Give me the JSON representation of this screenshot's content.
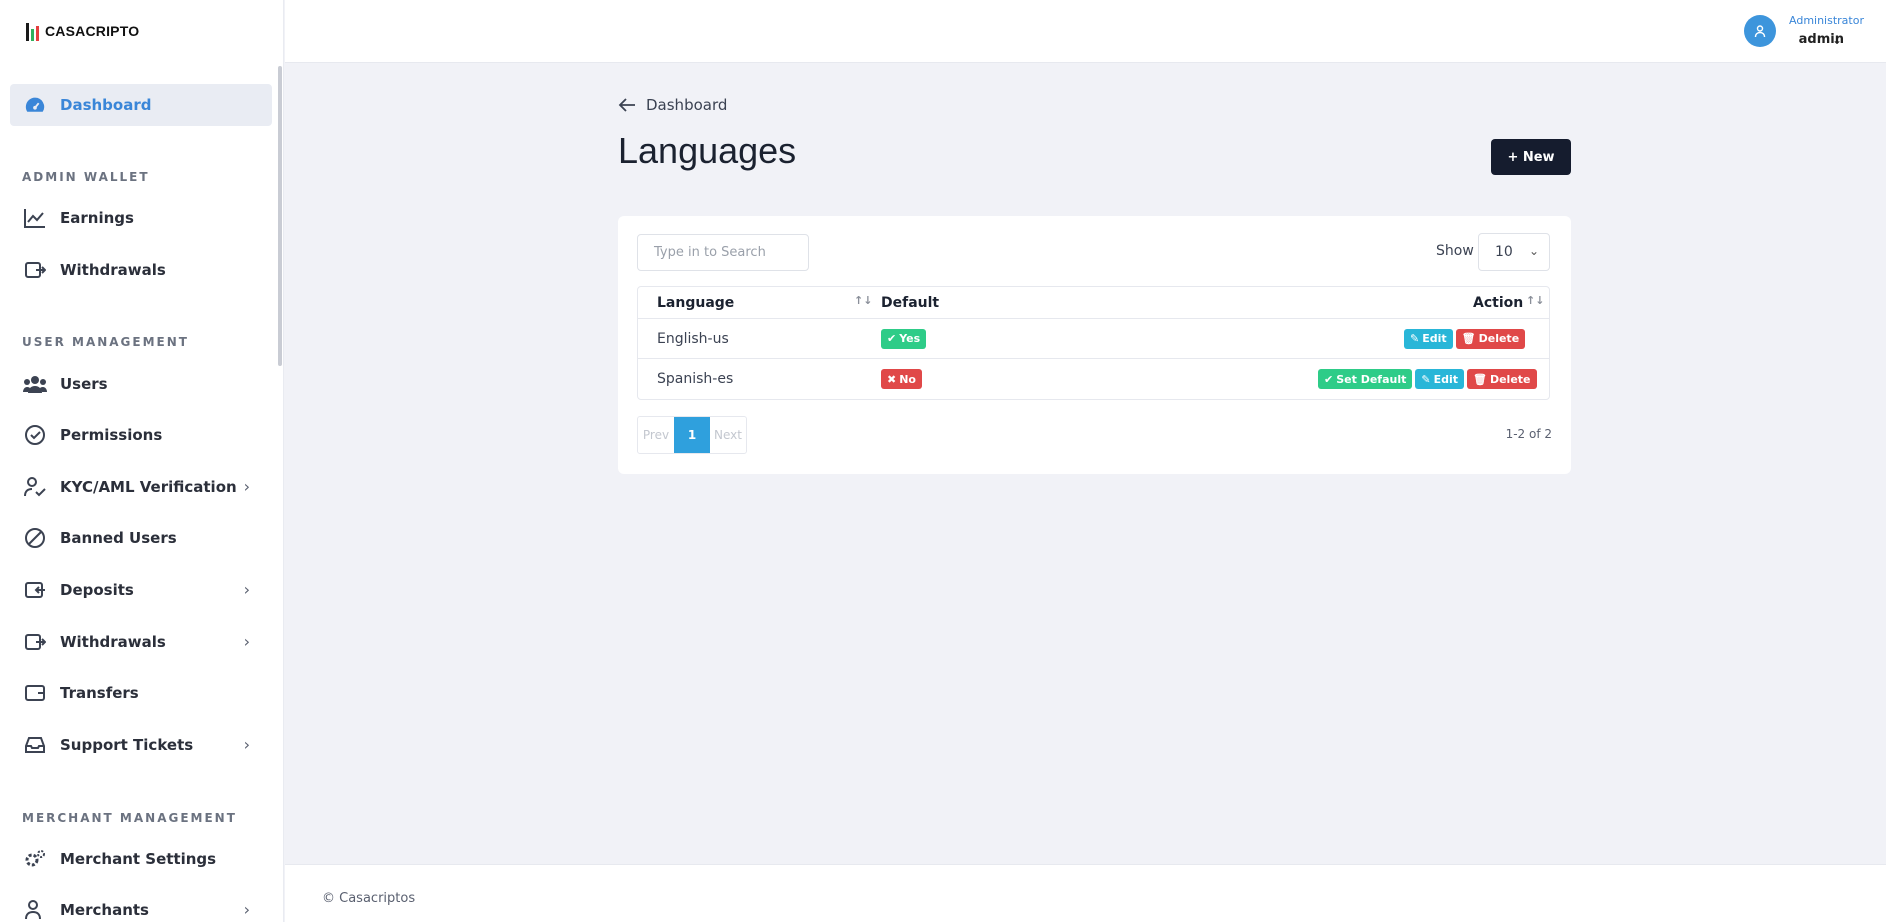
{
  "brand": {
    "name": "CASACRIPTO"
  },
  "user": {
    "role": "Administrator",
    "name": "admin"
  },
  "sidebar": {
    "dashboard": "Dashboard",
    "sections": {
      "admin_wallet": "ADMIN WALLET",
      "user_management": "USER MANAGEMENT",
      "merchant_management": "MERCHANT MANAGEMENT"
    },
    "items": {
      "earnings": "Earnings",
      "withdrawals_admin": "Withdrawals",
      "users": "Users",
      "permissions": "Permissions",
      "kyc": "KYC/AML Verification",
      "banned": "Banned Users",
      "deposits": "Deposits",
      "withdrawals": "Withdrawals",
      "transfers": "Transfers",
      "support": "Support Tickets",
      "merchant_settings": "Merchant Settings",
      "merchants": "Merchants"
    }
  },
  "page": {
    "breadcrumb": "Dashboard",
    "title": "Languages",
    "new_button": "+ New"
  },
  "table": {
    "search_placeholder": "Type in to Search",
    "show_label": "Show",
    "page_size": "10",
    "headers": {
      "language": "Language",
      "default": "Default",
      "action": "Action"
    },
    "rows": [
      {
        "language": "English-us",
        "default": "Yes",
        "actions": [
          "Edit",
          "Delete"
        ]
      },
      {
        "language": "Spanish-es",
        "default": "No",
        "actions": [
          "Set Default",
          "Edit",
          "Delete"
        ]
      }
    ],
    "pager": {
      "prev": "Prev",
      "current": "1",
      "next": "Next"
    },
    "range": "1-2 of 2"
  },
  "footer": {
    "text": "© Casacriptos"
  },
  "colors": {
    "accent": "#3a86d8",
    "dark_button": "#151c2e",
    "yes": "#2ecc88",
    "no": "#e04848",
    "edit": "#29b6d8"
  }
}
